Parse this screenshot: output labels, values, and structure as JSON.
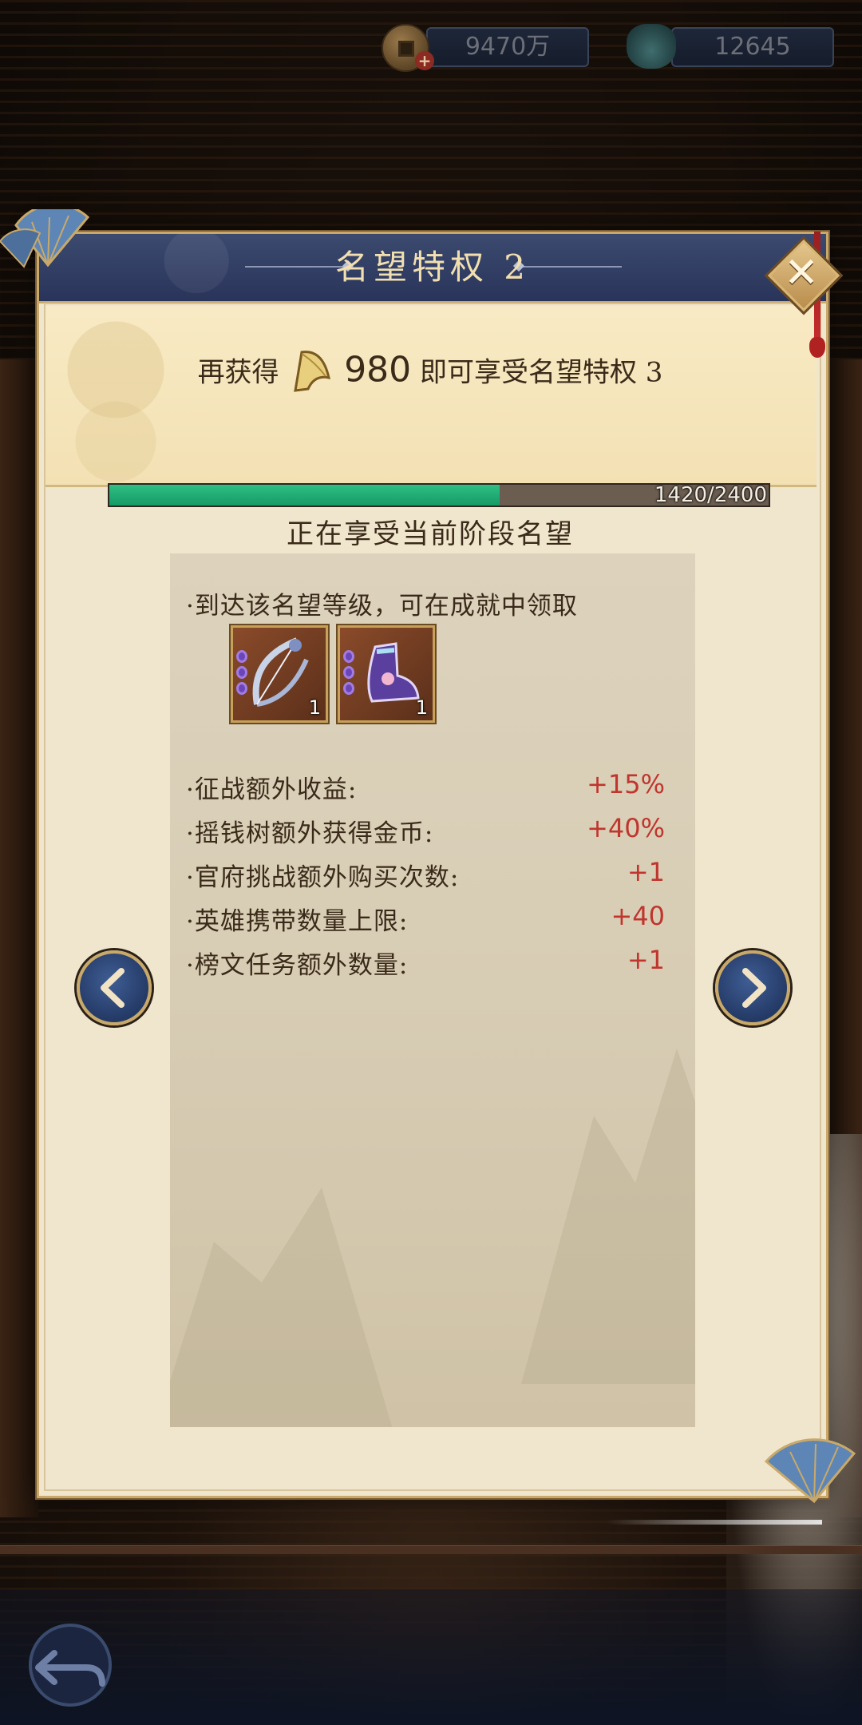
{
  "resources": {
    "gold": {
      "icon": "copper-coin-icon",
      "value": "9470万"
    },
    "currency": {
      "icon": "jade-pouch-icon",
      "value": "12645"
    }
  },
  "dialog": {
    "title": "名望特权 2",
    "gain": {
      "prefix": "再获得",
      "amount": "980",
      "suffix": "即可享受名望特权 3",
      "icon": "horn-icon"
    },
    "progress": {
      "current": 1420,
      "max": 2400,
      "text": "1420/2400",
      "fraction": 0.592
    },
    "status": "正在享受当前阶段名望",
    "claim_text": "·到达该名望等级，可在成就中领取",
    "rewards": [
      {
        "name": "bow-reward-icon",
        "count": "1"
      },
      {
        "name": "boots-reward-icon",
        "count": "1"
      }
    ],
    "bonuses": [
      {
        "label": "·征战额外收益:",
        "value": "+15%"
      },
      {
        "label": "·摇钱树额外获得金币:",
        "value": "+40%"
      },
      {
        "label": "·官府挑战额外购买次数:",
        "value": "+1"
      },
      {
        "label": "·英雄携带数量上限:",
        "value": "+40"
      },
      {
        "label": "·榜文任务额外数量:",
        "value": "+1"
      }
    ]
  },
  "colors": {
    "title_bar": "#29345a",
    "progress_fill": "#169a66",
    "bonus_value": "#c0352e",
    "panel_bg": "#efe6cd"
  }
}
